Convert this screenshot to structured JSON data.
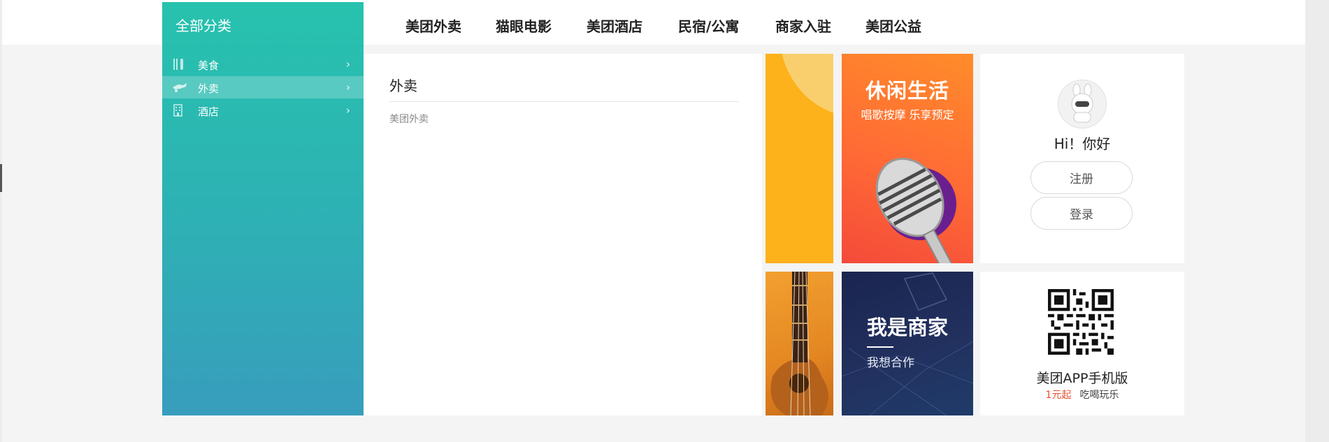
{
  "sidebar": {
    "title": "全部分类",
    "items": [
      {
        "label": "美食",
        "chevron": "›",
        "icon": "utensils-icon"
      },
      {
        "label": "外卖",
        "chevron": "›",
        "icon": "delivery-icon"
      },
      {
        "label": "酒店",
        "chevron": "›",
        "icon": "building-icon"
      }
    ]
  },
  "nav": {
    "items": [
      "美团外卖",
      "猫眼电影",
      "美团酒店",
      "民宿/公寓",
      "商家入驻",
      "美团公益"
    ]
  },
  "content": {
    "title": "外卖",
    "links": [
      "美团外卖"
    ]
  },
  "banners": {
    "leisure": {
      "title": "休闲生活",
      "subtitle": "唱歌按摩 乐享预定"
    },
    "merchant": {
      "title": "我是商家",
      "subtitle": "我想合作"
    }
  },
  "user": {
    "greeting": "Hi！你好",
    "register_label": "注册",
    "login_label": "登录"
  },
  "app": {
    "title": "美团APP手机版",
    "tag_red": "1元起",
    "tag_grey": "吃喝玩乐"
  },
  "colors": {
    "accent": "#27c2ae",
    "promo_red": "#e9502f"
  }
}
